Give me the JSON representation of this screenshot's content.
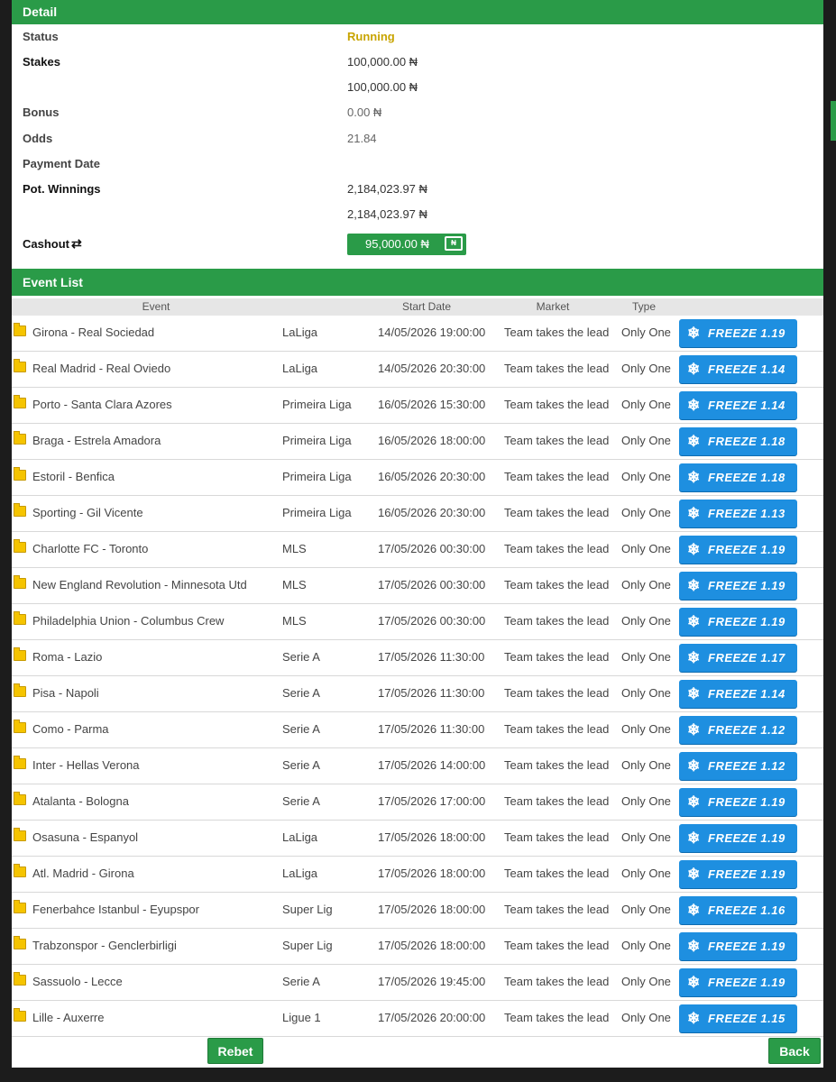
{
  "detail": {
    "header": "Detail",
    "status_label": "Status",
    "status_value": "Running",
    "stakes_label": "Stakes",
    "stakes_value_1": "100,000.00 ₦",
    "stakes_value_2": "100,000.00 ₦",
    "bonus_label": "Bonus",
    "bonus_value": "0.00 ₦",
    "odds_label": "Odds",
    "odds_value": "21.84",
    "payment_date_label": "Payment Date",
    "pot_winnings_label": "Pot. Winnings",
    "pot_winnings_value_1": "2,184,023.97 ₦",
    "pot_winnings_value_2": "2,184,023.97 ₦",
    "cashout_label": "Cashout",
    "cashout_value": "95,000.00 ₦",
    "cashout_icon_text": "₦"
  },
  "event_list": {
    "header": "Event List",
    "columns": [
      "Event",
      "Start Date",
      "Market",
      "Type"
    ],
    "rows": [
      {
        "event": "Girona - Real Sociedad",
        "league": "LaLiga",
        "start": "14/05/2026 19:00:00",
        "market": "Team takes the lead",
        "type": "Only One",
        "freeze": "FREEZE 1.19"
      },
      {
        "event": "Real Madrid - Real Oviedo",
        "league": "LaLiga",
        "start": "14/05/2026 20:30:00",
        "market": "Team takes the lead",
        "type": "Only One",
        "freeze": "FREEZE 1.14"
      },
      {
        "event": "Porto - Santa Clara Azores",
        "league": "Primeira Liga",
        "start": "16/05/2026 15:30:00",
        "market": "Team takes the lead",
        "type": "Only One",
        "freeze": "FREEZE 1.14"
      },
      {
        "event": "Braga - Estrela Amadora",
        "league": "Primeira Liga",
        "start": "16/05/2026 18:00:00",
        "market": "Team takes the lead",
        "type": "Only One",
        "freeze": "FREEZE 1.18"
      },
      {
        "event": "Estoril - Benfica",
        "league": "Primeira Liga",
        "start": "16/05/2026 20:30:00",
        "market": "Team takes the lead",
        "type": "Only One",
        "freeze": "FREEZE 1.18"
      },
      {
        "event": "Sporting - Gil Vicente",
        "league": "Primeira Liga",
        "start": "16/05/2026 20:30:00",
        "market": "Team takes the lead",
        "type": "Only One",
        "freeze": "FREEZE 1.13"
      },
      {
        "event": "Charlotte FC - Toronto",
        "league": "MLS",
        "start": "17/05/2026 00:30:00",
        "market": "Team takes the lead",
        "type": "Only One",
        "freeze": "FREEZE 1.19"
      },
      {
        "event": "New England Revolution - Minnesota Utd",
        "league": "MLS",
        "start": "17/05/2026 00:30:00",
        "market": "Team takes the lead",
        "type": "Only One",
        "freeze": "FREEZE 1.19"
      },
      {
        "event": "Philadelphia Union - Columbus Crew",
        "league": "MLS",
        "start": "17/05/2026 00:30:00",
        "market": "Team takes the lead",
        "type": "Only One",
        "freeze": "FREEZE 1.19"
      },
      {
        "event": "Roma - Lazio",
        "league": "Serie A",
        "start": "17/05/2026 11:30:00",
        "market": "Team takes the lead",
        "type": "Only One",
        "freeze": "FREEZE 1.17"
      },
      {
        "event": "Pisa - Napoli",
        "league": "Serie A",
        "start": "17/05/2026 11:30:00",
        "market": "Team takes the lead",
        "type": "Only One",
        "freeze": "FREEZE 1.14"
      },
      {
        "event": "Como - Parma",
        "league": "Serie A",
        "start": "17/05/2026 11:30:00",
        "market": "Team takes the lead",
        "type": "Only One",
        "freeze": "FREEZE 1.12"
      },
      {
        "event": "Inter - Hellas Verona",
        "league": "Serie A",
        "start": "17/05/2026 14:00:00",
        "market": "Team takes the lead",
        "type": "Only One",
        "freeze": "FREEZE 1.12"
      },
      {
        "event": "Atalanta - Bologna",
        "league": "Serie A",
        "start": "17/05/2026 17:00:00",
        "market": "Team takes the lead",
        "type": "Only One",
        "freeze": "FREEZE 1.19"
      },
      {
        "event": "Osasuna - Espanyol",
        "league": "LaLiga",
        "start": "17/05/2026 18:00:00",
        "market": "Team takes the lead",
        "type": "Only One",
        "freeze": "FREEZE 1.19"
      },
      {
        "event": "Atl. Madrid - Girona",
        "league": "LaLiga",
        "start": "17/05/2026 18:00:00",
        "market": "Team takes the lead",
        "type": "Only One",
        "freeze": "FREEZE 1.19"
      },
      {
        "event": "Fenerbahce Istanbul - Eyupspor",
        "league": "Super Lig",
        "start": "17/05/2026 18:00:00",
        "market": "Team takes the lead",
        "type": "Only One",
        "freeze": "FREEZE 1.16"
      },
      {
        "event": "Trabzonspor - Genclerbirligi",
        "league": "Super Lig",
        "start": "17/05/2026 18:00:00",
        "market": "Team takes the lead",
        "type": "Only One",
        "freeze": "FREEZE 1.19"
      },
      {
        "event": "Sassuolo - Lecce",
        "league": "Serie A",
        "start": "17/05/2026 19:45:00",
        "market": "Team takes the lead",
        "type": "Only One",
        "freeze": "FREEZE 1.19"
      },
      {
        "event": "Lille - Auxerre",
        "league": "Ligue 1",
        "start": "17/05/2026 20:00:00",
        "market": "Team takes the lead",
        "type": "Only One",
        "freeze": "FREEZE 1.15"
      }
    ]
  },
  "actions": {
    "rebet_label": "Rebet",
    "back_label": "Back"
  },
  "icons": {
    "refresh": "refresh-icon",
    "folder": "folder-icon",
    "freeze": "snowflake-icon",
    "cashout": "cash-icon"
  },
  "colors": {
    "header_green": "#2a9b48",
    "running_yellow": "#c8a400",
    "freeze_blue": "#1e8fe0"
  }
}
